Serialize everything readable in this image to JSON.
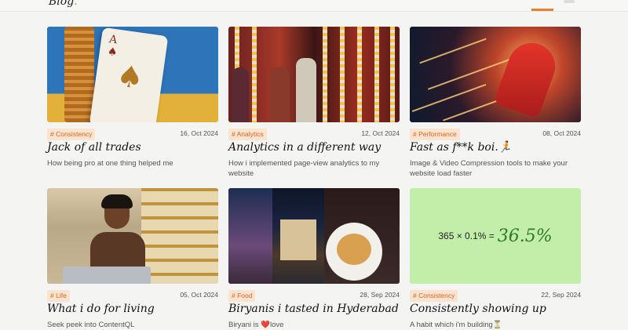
{
  "header": {
    "logo": "Blog",
    "logo_dot": "."
  },
  "posts": [
    {
      "tag": "# Consistency",
      "date": "16, Oct 2024",
      "title": "Jack of all trades",
      "description": "How being pro at one thing helped me",
      "image": "playing-card-ace-of-spades"
    },
    {
      "tag": "# Analytics",
      "date": "12, Oct 2024",
      "title": "Analytics in a different way",
      "description": "How i implemented page-view analytics to my website",
      "image": "people-at-decorated-doorway"
    },
    {
      "tag": "# Performance",
      "date": "08, Oct 2024",
      "title": "Fast as f**k boi.🏃",
      "description": "Image & Video Compression tools to make your website load faster",
      "image": "speedster-running"
    },
    {
      "tag": "# Life",
      "date": "05, Oct 2024",
      "title": "What i do for living",
      "description": "Seek peek into ContentQL",
      "image": "man-with-laptop"
    },
    {
      "tag": "# Food",
      "date": "28, Sep 2024",
      "title": "Biryanis i tasted in Hyderabad",
      "description": "Biryani is ❤️love",
      "image": "charminar-and-biryani"
    },
    {
      "tag": "# Consistency",
      "date": "22, Sep 2024",
      "title": "Consistently showing up",
      "description": "A habit which i'm building⏳",
      "image": "formula-card",
      "formula_left": "365 × 0.1% =",
      "formula_result": "36.5%"
    }
  ],
  "colors": {
    "accent": "#e8812e",
    "tag_bg": "#fbe3cf",
    "tag_text": "#d4692a",
    "formula_bg": "#c3eeaa"
  }
}
